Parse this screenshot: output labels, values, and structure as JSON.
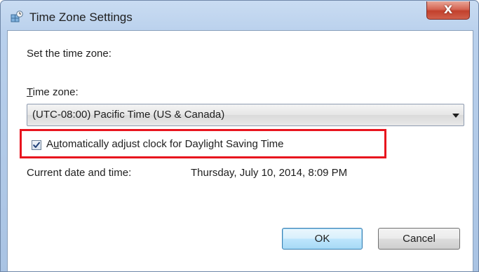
{
  "window": {
    "title": "Time Zone Settings",
    "icon": "clock-globe-icon",
    "close_glyph": "X"
  },
  "dialog": {
    "heading": "Set the time zone:",
    "time_zone_label_accel": "T",
    "time_zone_label_rest": "ime zone:",
    "time_zone_value": "(UTC-08:00) Pacific Time (US & Canada)",
    "dst_checked": true,
    "dst_label_pre": "A",
    "dst_label_accel": "u",
    "dst_label_rest": "tomatically adjust clock for Daylight Saving Time",
    "current_label": "Current date and time:",
    "current_value": "Thursday, July 10, 2014, 8:09 PM",
    "ok_label": "OK",
    "cancel_label": "Cancel"
  },
  "colors": {
    "highlight": "#e8141e",
    "close_button": "#c2402c",
    "title_bar": "#b9d0ec"
  }
}
